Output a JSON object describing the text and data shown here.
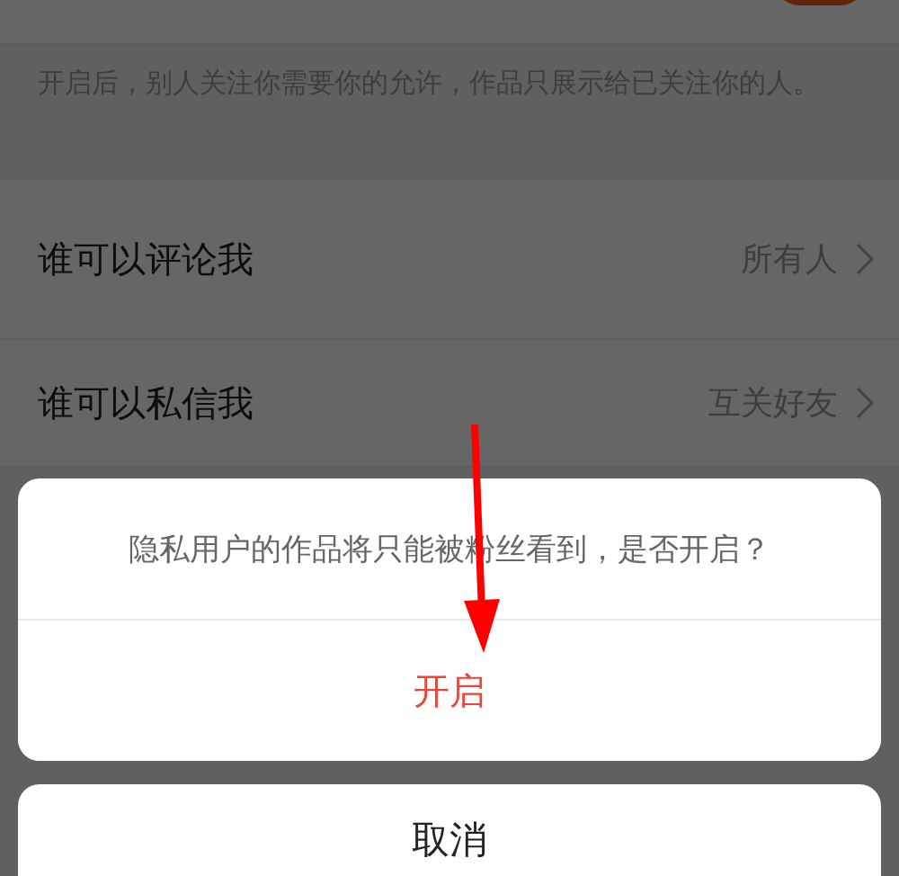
{
  "privacy_toggle": {
    "on": true
  },
  "note": "开启后，别人关注你需要你的允许，作品只展示给已关注你的人。",
  "settings": [
    {
      "label": "谁可以评论我",
      "value": "所有人"
    },
    {
      "label": "谁可以私信我",
      "value": "互关好友"
    }
  ],
  "dialog": {
    "message": "隐私用户的作品将只能被粉丝看到，是否开启？",
    "confirm": "开启",
    "cancel": "取消"
  }
}
